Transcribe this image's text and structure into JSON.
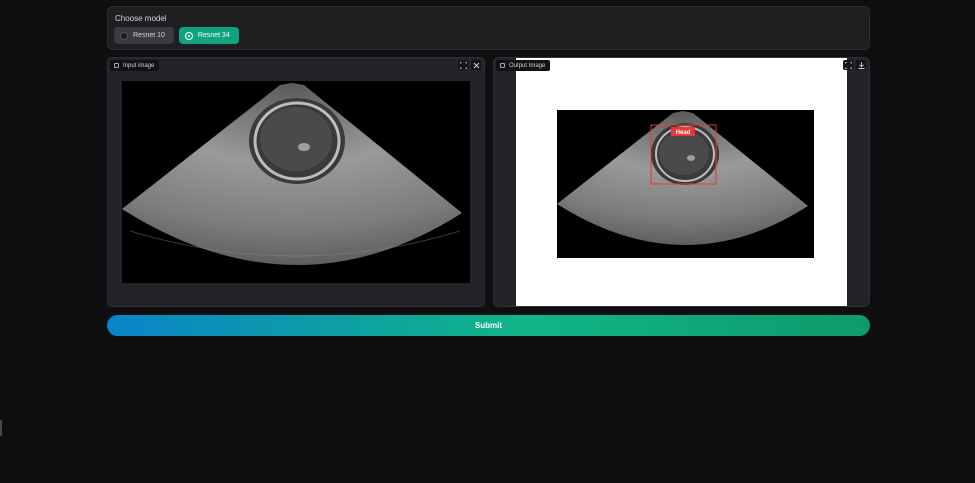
{
  "model_selector": {
    "label": "Choose model",
    "options": [
      {
        "label": "Resnet 10",
        "selected": false
      },
      {
        "label": "Resnet 34",
        "selected": true
      }
    ]
  },
  "input_panel": {
    "label": "Input image",
    "icons": [
      "image-icon",
      "fullscreen-icon",
      "close-icon"
    ]
  },
  "output_panel": {
    "label": "Output Image",
    "icons": [
      "image-icon",
      "fullscreen-icon",
      "download-icon"
    ],
    "detection": {
      "label": "Head",
      "box_color": "#e53935"
    }
  },
  "submit": {
    "label": "Submit"
  },
  "colors": {
    "background": "#0f0f11",
    "panel": "#1f1f22",
    "accent_green": "#10a37f",
    "gradient_start": "#0a84c8",
    "gradient_end": "#0e9a6c"
  }
}
